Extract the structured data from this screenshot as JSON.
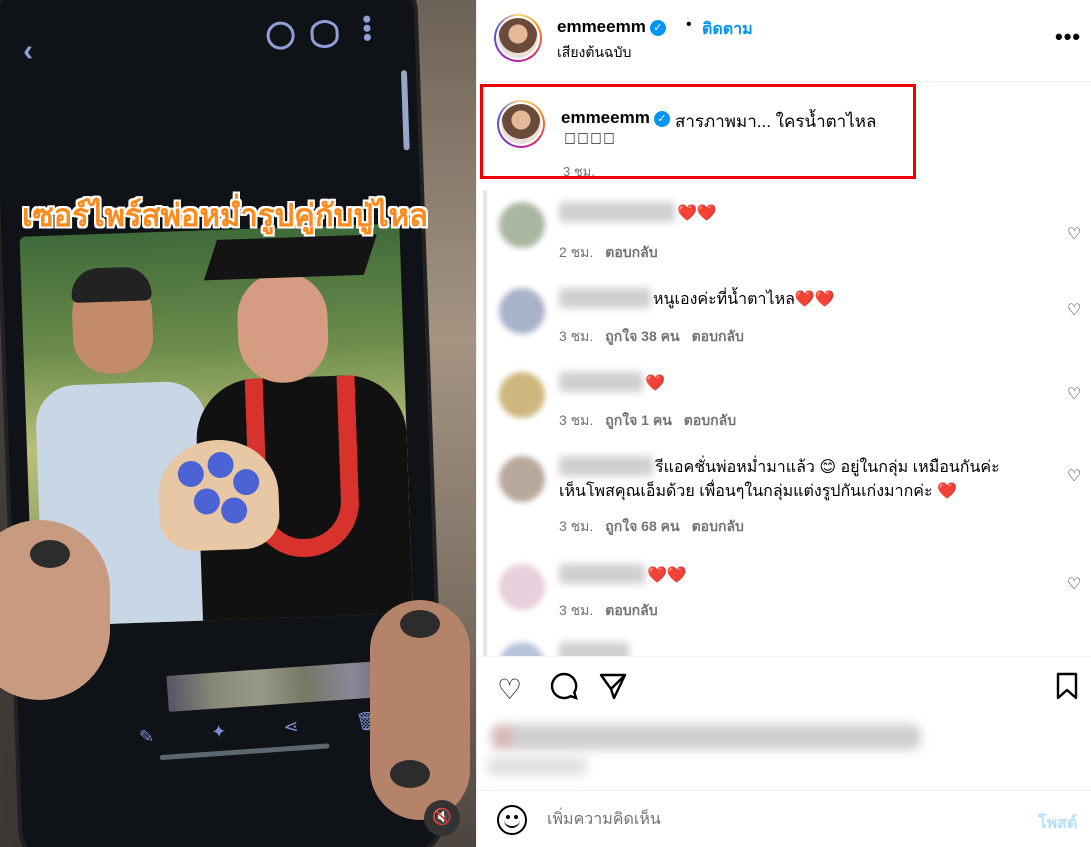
{
  "media": {
    "overlay_text": "เซอร์ไพร์สพ่อหม่ำรูปคู่กับปู่ไหล"
  },
  "header": {
    "username": "emmeemm",
    "follow_label": "ติดตาม",
    "audio_label": "เสียงต้นฉบับ"
  },
  "caption": {
    "username": "emmeemm",
    "text": "สารภาพมา... ใครน้ำตาไหล",
    "emoji": "􀀀􀀀􀀀􀀀",
    "time": "3 ชม."
  },
  "comments": [
    {
      "text": "",
      "hearts": "❤️❤️",
      "time": "2 ชม.",
      "likes": "",
      "reply": "ตอบกลับ"
    },
    {
      "text": "หนูเองค่ะที่น้ำตาไหล",
      "hearts": "❤️❤️",
      "time": "3 ชม.",
      "likes": "ถูกใจ 38 คน",
      "reply": "ตอบกลับ"
    },
    {
      "text": "",
      "hearts": "❤️",
      "time": "3 ชม.",
      "likes": "ถูกใจ 1 คน",
      "reply": "ตอบกลับ"
    },
    {
      "text": "รีแอคชั่นพ่อหม่ำมาแล้ว 😊 อยู่ในกลุ่ม เหมือนกันค่ะ",
      "text2": "เห็นโพสคุณเอ็มด้วย เพื่อนๆในกลุ่มแต่งรูปกันเก่งมากค่ะ",
      "hearts": "❤️",
      "time": "3 ชม.",
      "likes": "ถูกใจ 68 คน",
      "reply": "ตอบกลับ"
    },
    {
      "text": "",
      "hearts": "❤️❤️",
      "time": "3 ชม.",
      "likes": "",
      "reply": "ตอบกลับ"
    }
  ],
  "add_comment": {
    "placeholder": "เพิ่มความคิดเห็น",
    "post_label": "โพสต์"
  },
  "colors": {
    "accent": "#0095f6",
    "highlight_border": "#ee0000",
    "overlay_text": "#ff8b1f"
  },
  "icons": [
    "back-icon",
    "cast-icon",
    "eye-icon",
    "more-vertical-icon",
    "mute-icon",
    "verified-icon",
    "more-horizontal-icon",
    "heart-icon",
    "comment-icon",
    "share-icon",
    "bookmark-icon",
    "emoji-icon"
  ]
}
